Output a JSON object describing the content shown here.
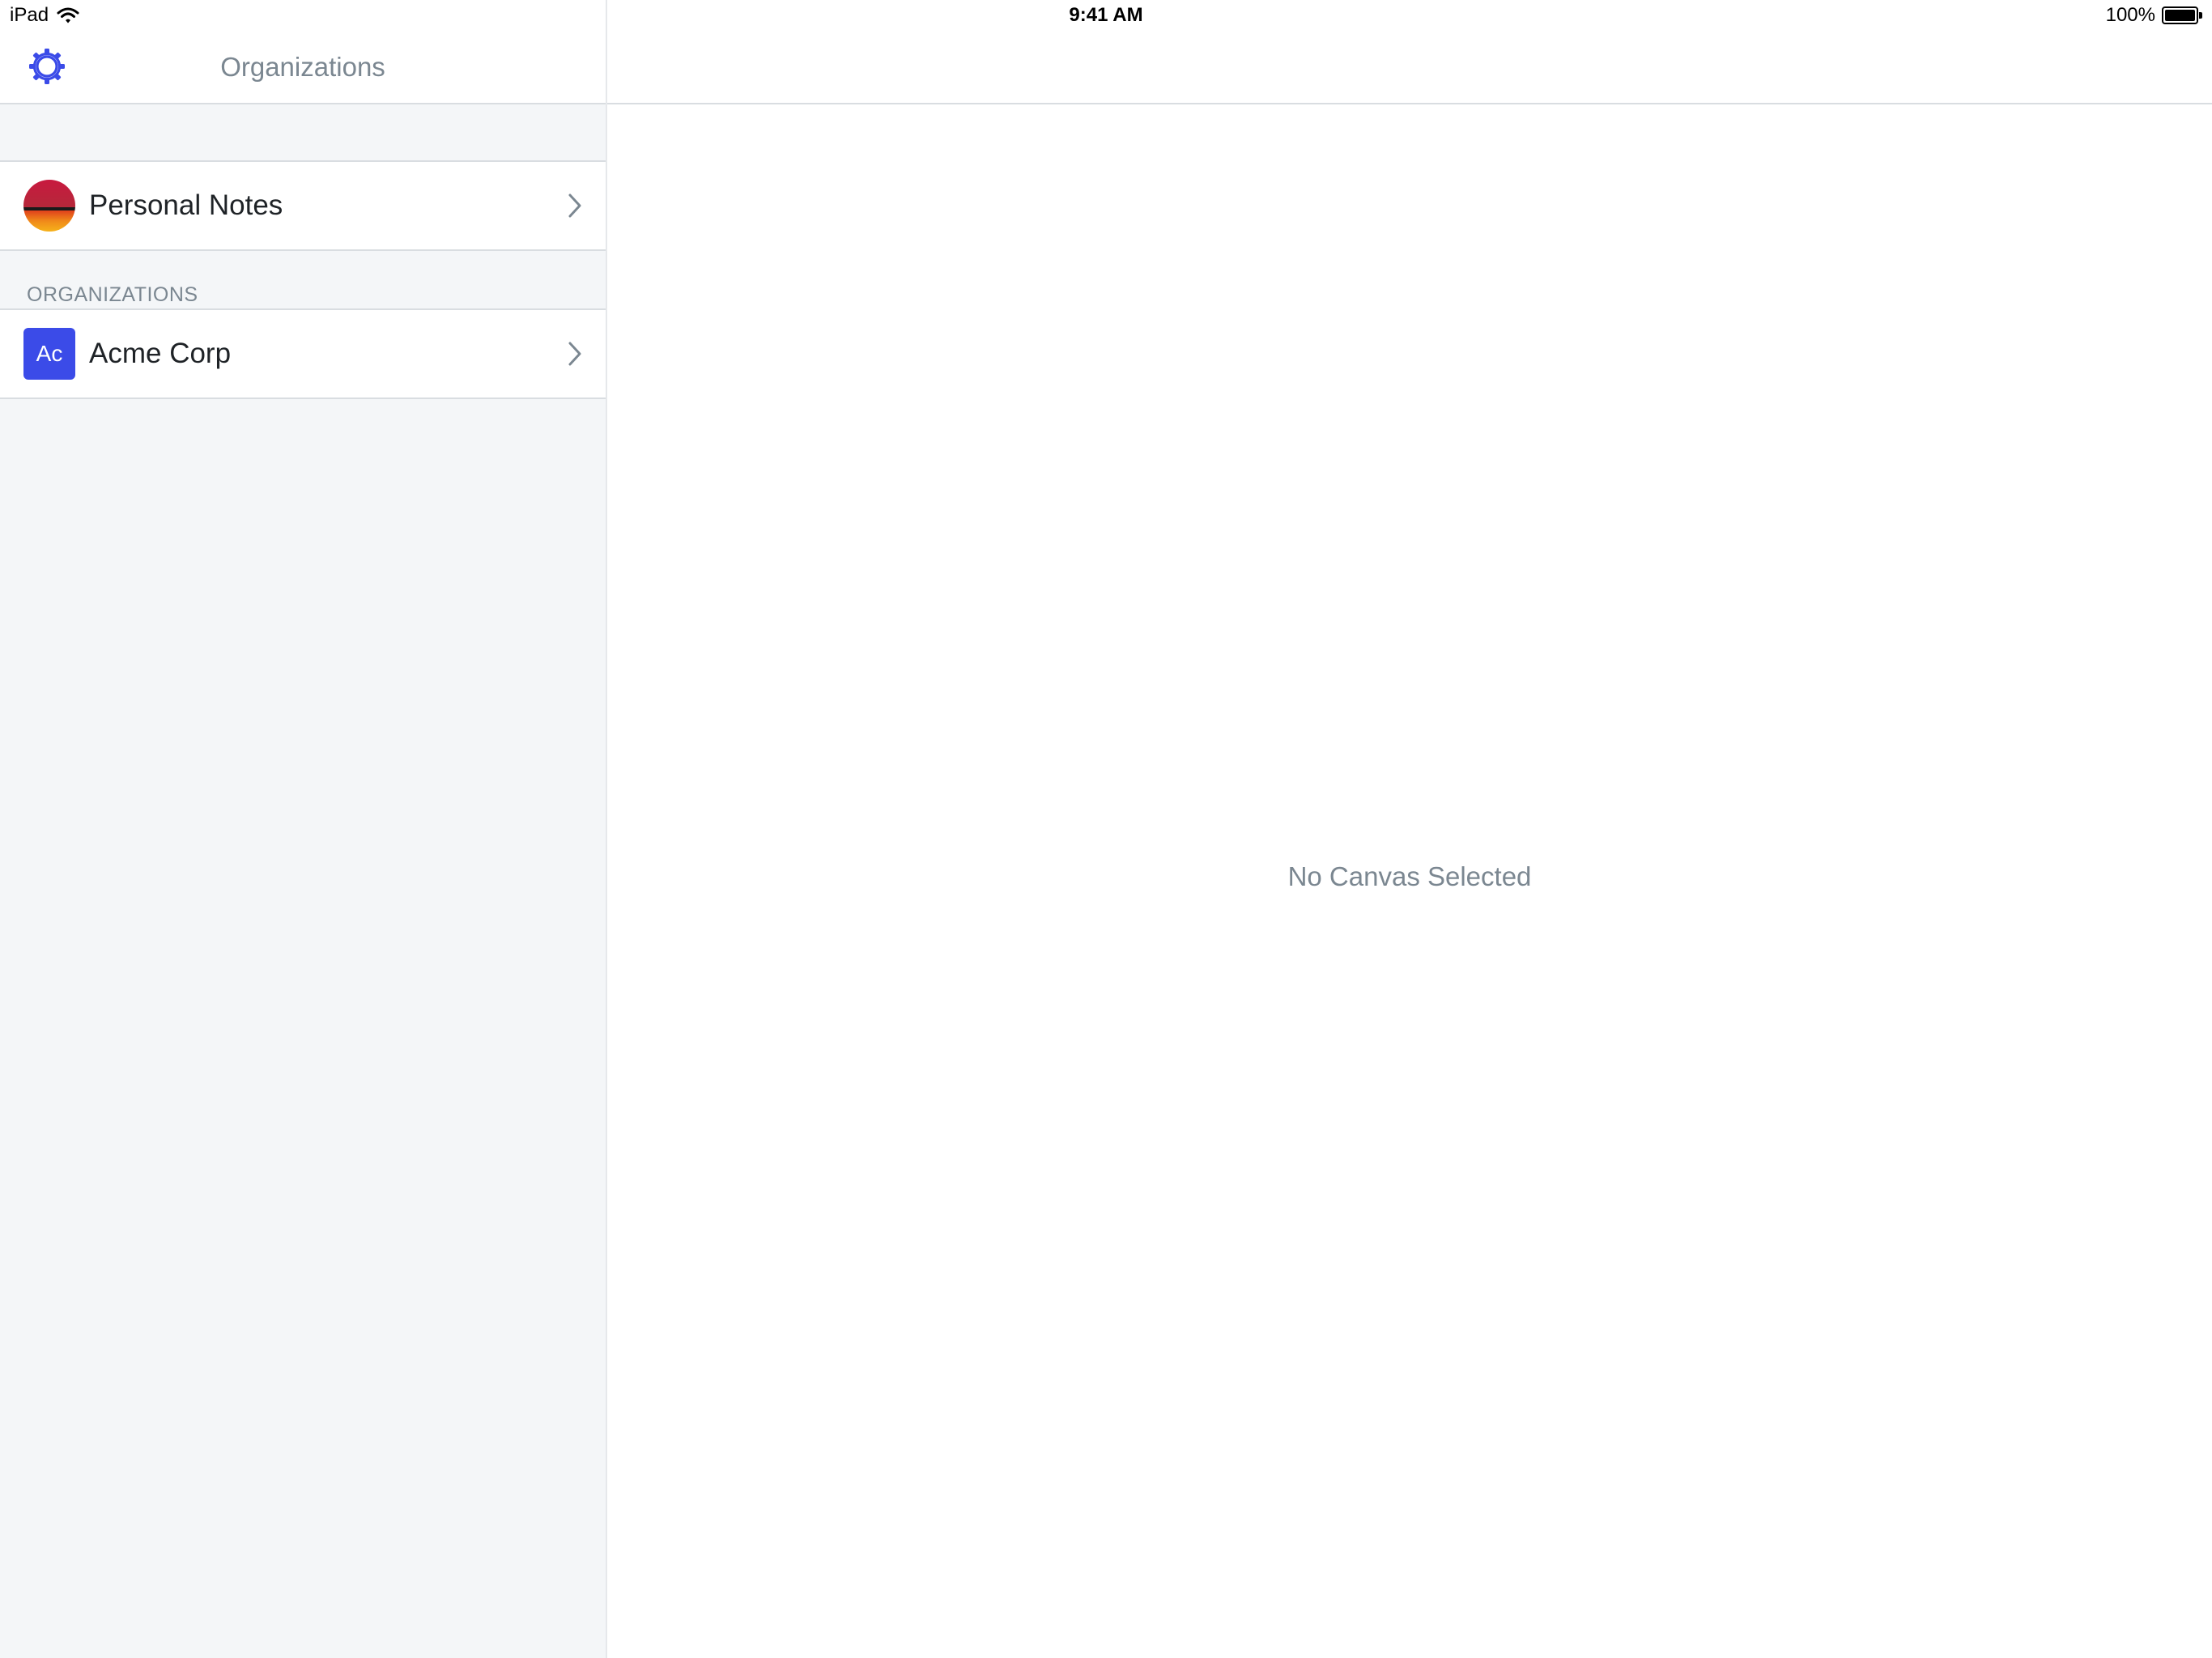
{
  "status_bar": {
    "device": "iPad",
    "time": "9:41 AM",
    "battery": "100%",
    "battery_level": 1.0
  },
  "sidebar": {
    "title": "Organizations",
    "settings_icon": "gear-icon",
    "personal": {
      "label": "Personal Notes",
      "avatar": "sunset-avatar"
    },
    "section_header": "ORGANIZATIONS",
    "organizations": [
      {
        "label": "Acme Corp",
        "initials": "Ac",
        "color": "#3b4be8"
      }
    ]
  },
  "detail": {
    "empty_message": "No Canvas Selected"
  },
  "colors": {
    "accent": "#3b4be8",
    "secondary_text": "#7b8791",
    "primary_text": "#1f2327",
    "sidebar_bg": "#f4f6f8",
    "separator": "#d9dde1"
  }
}
